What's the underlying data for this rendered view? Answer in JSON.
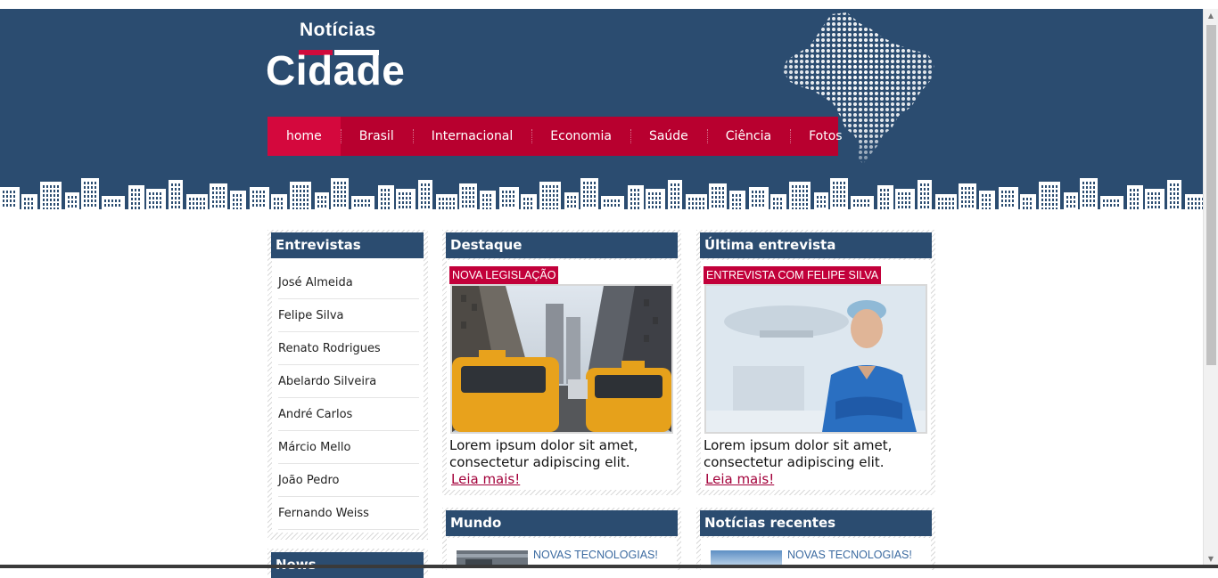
{
  "header": {
    "logo_top": "Notícias",
    "logo_main": "Cidade",
    "nav": [
      {
        "label": "home",
        "active": true
      },
      {
        "label": "Brasil"
      },
      {
        "label": "Internacional"
      },
      {
        "label": "Economia"
      },
      {
        "label": "Saúde"
      },
      {
        "label": "Ciência"
      },
      {
        "label": "Fotos"
      }
    ]
  },
  "sidebar": {
    "title": "Entrevistas",
    "items": [
      "José Almeida",
      "Felipe Silva",
      "Renato Rodrigues",
      "Abelardo Silveira",
      "André Carlos",
      "Márcio Mello",
      "João Pedro",
      "Fernando Weiss"
    ],
    "next_title": "News"
  },
  "destaque": {
    "title": "Destaque",
    "tag": "NOVA LEGISLAÇÃO",
    "summary_line1": "Lorem ipsum dolor sit amet,",
    "summary_line2": "consectetur adipiscing elit.",
    "link": "Leia mais!"
  },
  "entrevista": {
    "title": "Última entrevista",
    "tag": "ENTREVISTA COM FELIPE SILVA",
    "summary_line1": "Lorem ipsum dolor sit amet,",
    "summary_line2": "consectetur adipiscing elit.",
    "link": "Leia mais!"
  },
  "mundo": {
    "title": "Mundo",
    "first_item": "NOVAS TECNOLOGIAS!"
  },
  "recentes": {
    "title": "Notícias recentes",
    "first_item": "NOVAS TECNOLOGIAS!"
  },
  "colors": {
    "header_bg": "#2b4c70",
    "nav_bg": "#b8002f",
    "nav_active": "#d4083d",
    "tag_bg": "#c2003a",
    "link": "#a3003a"
  }
}
